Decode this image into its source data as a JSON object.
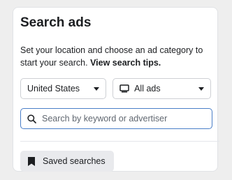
{
  "panel": {
    "title": "Search ads",
    "description": "Set your location and choose an ad category to start your search.",
    "tips_link": "View search tips."
  },
  "filters": {
    "country": "United States",
    "category": "All ads"
  },
  "search": {
    "placeholder": "Search by keyword or advertiser"
  },
  "saved_searches": {
    "label": "Saved searches"
  },
  "icons": {
    "category": "monitor-icon",
    "search": "search-icon",
    "saved": "bookmark-icon",
    "dropdown": "caret-down-icon"
  },
  "colors": {
    "focus_border": "#4a7ec8",
    "button_bg": "#e9eaed"
  }
}
